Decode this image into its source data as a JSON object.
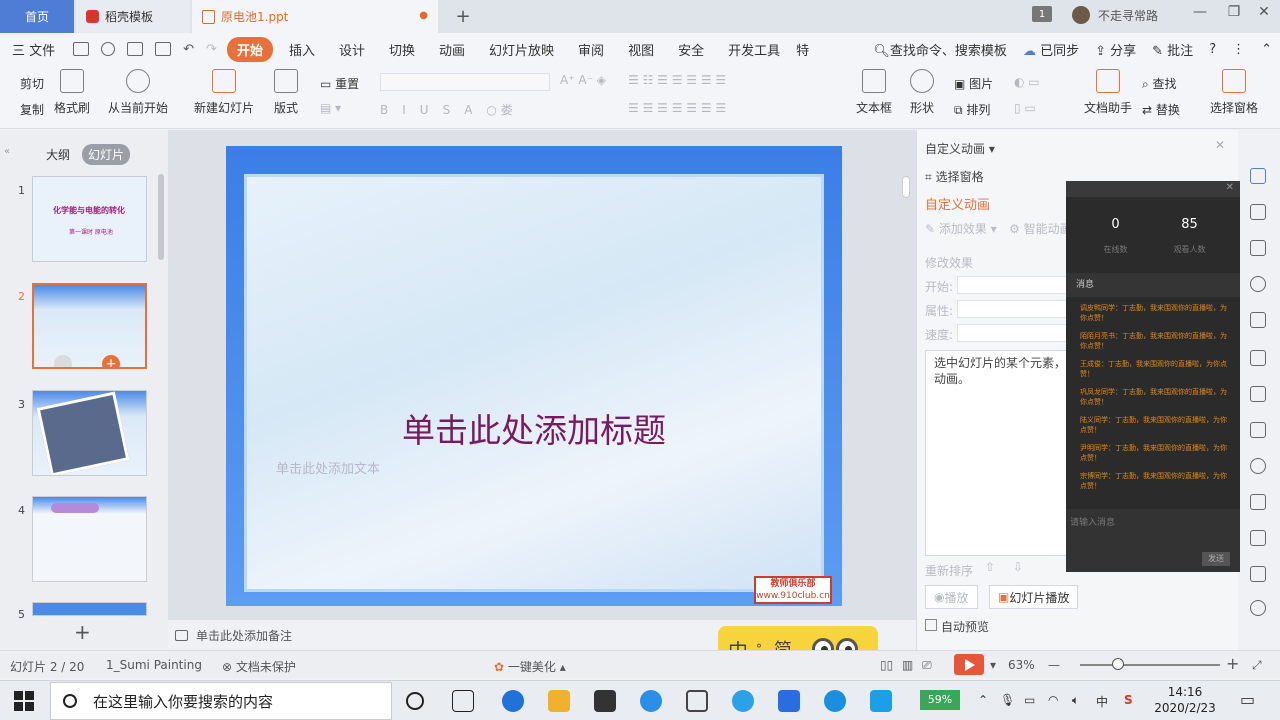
{
  "tabs": {
    "home": "首页",
    "template": "稻壳模板",
    "document": "原电池1.ppt",
    "add": "+"
  },
  "titlebar": {
    "badge": "1",
    "user": "不走寻常路"
  },
  "menu": {
    "file": "三 文件",
    "items": [
      "开始",
      "插入",
      "设计",
      "切换",
      "动画",
      "幻灯片放映",
      "审阅",
      "视图",
      "安全",
      "开发工具",
      "特"
    ],
    "search": "查找命令、搜索模板",
    "sync": "已同步",
    "share": "分享",
    "comment": "批注"
  },
  "ribbon": {
    "cut": "剪切",
    "copy": "复制",
    "format_painter": "格式刷",
    "from_current": "从当前开始",
    "new_slide": "新建幻灯片",
    "layout": "版式",
    "reset": "重置",
    "textbox": "文本框",
    "shape": "形状",
    "picture": "图片",
    "arrange": "排列",
    "doc_assistant": "文档助手",
    "find": "查找",
    "replace": "替换",
    "select_pane": "选择窗格"
  },
  "leftpanel": {
    "outline": "大纲",
    "slides": "幻灯片",
    "thumbs": [
      {
        "num": "1",
        "title": "化学能与电能的转化",
        "subtitle": "第一课时 原电池"
      },
      {
        "num": "2"
      },
      {
        "num": "3"
      },
      {
        "num": "4"
      },
      {
        "num": "5"
      }
    ],
    "add": "+"
  },
  "slide": {
    "title": "单击此处添加标题",
    "subtitle": "单击此处添加文本",
    "logo_line1": "教师俱乐部",
    "logo_line2": "www.910club.cn"
  },
  "notes": "单击此处添加备注",
  "animation": {
    "header": "自定义动画",
    "select_pane": "选择窗格",
    "title": "自定义动画",
    "add_effect": "添加效果",
    "delete": "智能动画",
    "modify": "修改效果",
    "start": "开始:",
    "property": "属性:",
    "speed": "速度:",
    "desc": "选中幻灯片的某个元素，然后单击添加效果。动画。",
    "desc_visible": "选中幻灯片的某个元素，动画。",
    "reorder": "重新排序",
    "play": "播放",
    "slideshow": "幻灯片播放",
    "auto_preview": "自动预览"
  },
  "chat": {
    "stat1_value": "0",
    "stat1_label": "在线数",
    "stat2_value": "85",
    "stat2_label": "观看人数",
    "messages_header": "消息",
    "messages": [
      "调皮鸭同学：丁志勤，我来围观你的直播啦，为你点赞！",
      "陌陌月亮书：丁志勤，我来围观你的直播啦，为你点赞！",
      "王成俊：丁志勤，我来围观你的直播啦，为你点赞！",
      "巩凤龙同学：丁志勤，我来围观你的直播啦，为你点赞！",
      "陆义同学：丁志勤，我来围观你的直播啦，为你点赞！",
      "尹明同学：丁志勤，我来围观你的直播啦，为你点赞！",
      "宗博同学：丁志勤，我来围观你的直播啦，为你点赞！"
    ],
    "input_placeholder": "请输入消息",
    "send": "发送"
  },
  "ime": {
    "lang": "中",
    "mode": "简"
  },
  "statusbar": {
    "slide_info": "幻灯片 2 / 20",
    "theme": "1_Sumi Painting",
    "protect": "文档未保护",
    "beautify": "一键美化",
    "zoom": "63%",
    "zoom_value": 0.63
  },
  "taskbar": {
    "search_placeholder": "在这里输入你要搜索的内容",
    "battery": "59%",
    "time": "14:16",
    "date": "2020/2/23"
  },
  "colors": {
    "accent": "#e8703a",
    "tab_blue": "#4f7cd4",
    "title_purple": "#7a1a5e"
  }
}
